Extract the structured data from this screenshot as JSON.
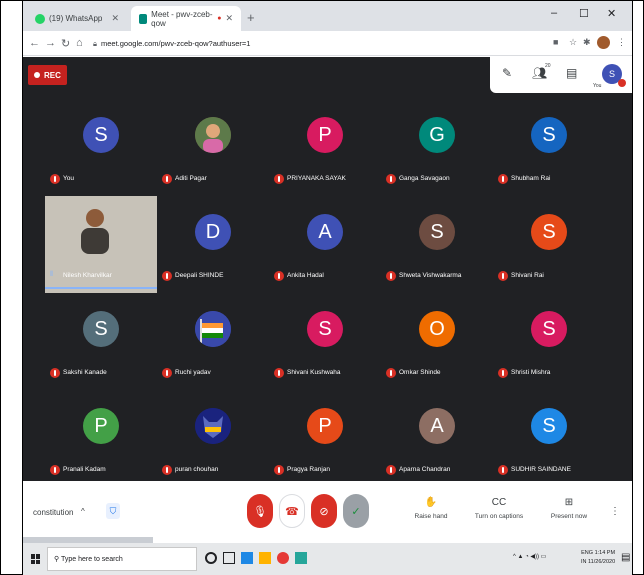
{
  "browser": {
    "tabs": [
      {
        "title": "(19) WhatsApp",
        "favicon_color": "#25d366"
      },
      {
        "title": "Meet - pwv-zceb-qow",
        "favicon_color": "#00897b"
      }
    ],
    "new_tab_glyph": "+",
    "window_controls": {
      "minimize": "–",
      "maximize": "☐",
      "close": "✕"
    },
    "url": "meet.google.com/pwv-zceb-qow?authuser=1"
  },
  "meet": {
    "rec_label": "REC",
    "participant_count": "20",
    "self_initial": "S",
    "self_label": "You",
    "participants": [
      {
        "name": "You",
        "initial": "S",
        "color": "#3f51b5",
        "kind": "letter"
      },
      {
        "name": "Aditi Pagar",
        "initial": "",
        "color": "#7b5a3a",
        "kind": "photo"
      },
      {
        "name": "PRIYANAKA SAYAK",
        "initial": "P",
        "color": "#d81b60",
        "kind": "letter"
      },
      {
        "name": "Ganga Savagaon",
        "initial": "G",
        "color": "#00897b",
        "kind": "letter"
      },
      {
        "name": "Shubham Rai",
        "initial": "S",
        "color": "#1565c0",
        "kind": "letter"
      },
      {
        "name": "Nilesh Kharvilkar",
        "initial": "",
        "color": "#c7c2b8",
        "kind": "video"
      },
      {
        "name": "Deepali SHINDE",
        "initial": "D",
        "color": "#3f51b5",
        "kind": "letter"
      },
      {
        "name": "Ankita Hadal",
        "initial": "A",
        "color": "#3f51b5",
        "kind": "letter"
      },
      {
        "name": "Shweta Vishwakarma",
        "initial": "S",
        "color": "#6d4c41",
        "kind": "letter"
      },
      {
        "name": "Shivani Rai",
        "initial": "S",
        "color": "#e64a19",
        "kind": "letter"
      },
      {
        "name": "Sakshi Kanade",
        "initial": "S",
        "color": "#546e7a",
        "kind": "letter"
      },
      {
        "name": "Ruchi yadav",
        "initial": "",
        "color": "#3949ab",
        "kind": "flag"
      },
      {
        "name": "Shivani Kushwaha",
        "initial": "S",
        "color": "#d81b60",
        "kind": "letter"
      },
      {
        "name": "Omkar Shinde",
        "initial": "O",
        "color": "#ef6c00",
        "kind": "letter"
      },
      {
        "name": "Shristi Mishra",
        "initial": "S",
        "color": "#d81b60",
        "kind": "letter"
      },
      {
        "name": "Pranali Kadam",
        "initial": "P",
        "color": "#43a047",
        "kind": "letter"
      },
      {
        "name": "puran chouhan",
        "initial": "",
        "color": "#1a237e",
        "kind": "badge"
      },
      {
        "name": "Pragya Ranjan",
        "initial": "P",
        "color": "#e64a19",
        "kind": "letter"
      },
      {
        "name": "Aparna Chandran",
        "initial": "A",
        "color": "#8d6e63",
        "kind": "letter"
      },
      {
        "name": "SUDHIR SAINDANE",
        "initial": "S",
        "color": "#1e88e5",
        "kind": "letter"
      }
    ]
  },
  "controls": {
    "meeting_name": "constitution",
    "meeting_chevron": "^",
    "raise_hand": "Raise hand",
    "captions": "Turn on captions",
    "present": "Present now",
    "captions_glyph": "CC",
    "present_glyph": "⊞",
    "raise_glyph": "✋",
    "more_glyph": "⋮"
  },
  "taskbar": {
    "search_placeholder": "Type here to search",
    "tray_lang": "ENG",
    "tray_region": "IN",
    "time": "1:14 PM",
    "date": "11/26/2020"
  },
  "colors": {
    "stage_bg": "#202124",
    "meet_red": "#d93025",
    "accent_blue": "#1a73e8"
  }
}
